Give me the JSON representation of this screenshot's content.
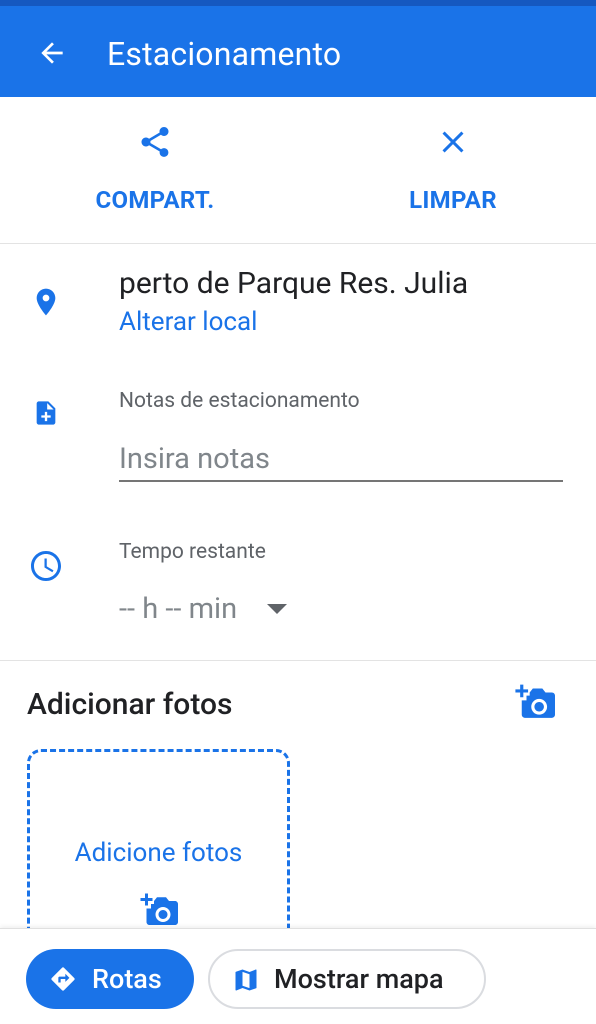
{
  "header": {
    "title": "Estacionamento",
    "back_icon": "arrow-back-icon"
  },
  "actions": {
    "share_label": "COMPART.",
    "clear_label": "LIMPAR"
  },
  "location": {
    "text": "perto de Parque Res. Julia",
    "change_label": "Alterar local"
  },
  "notes": {
    "label": "Notas de estacionamento",
    "placeholder": "Insira notas",
    "value": ""
  },
  "time": {
    "label": "Tempo restante",
    "value": "-- h -- min"
  },
  "photos": {
    "title": "Adicionar fotos",
    "box_label": "Adicione fotos"
  },
  "bottom": {
    "routes_label": "Rotas",
    "map_label": "Mostrar mapa"
  },
  "colors": {
    "accent": "#1a73e8",
    "text": "#202124",
    "secondary_text": "#5f6368"
  }
}
